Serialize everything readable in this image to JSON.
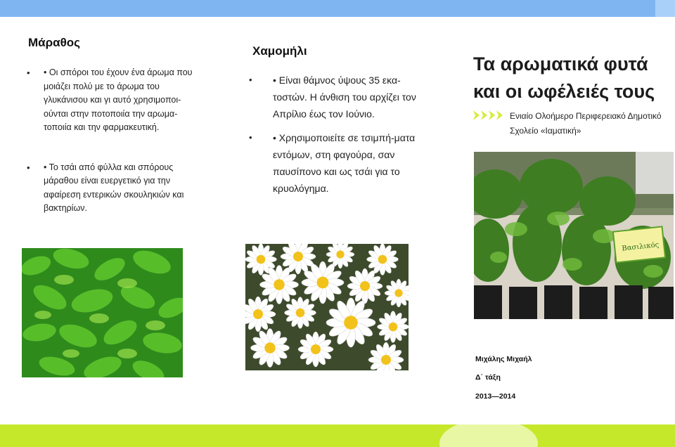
{
  "left_panel": {
    "heading": "Μάραθος",
    "items": [
      "• Οι σπόροι του έχουν ένα άρωμα που μοιάζει πολύ με το άρωμα του γλυκάνισου και γι αυτό χρησιμοποι-ούνται στην ποτοποιία την αρωμα-τοποιία και την φαρμακευτική.",
      "• Το τσάι από φύλλα και σπόρους μάραθου είναι ευεργετικό για την αφαίρεση εντερικών σκουληκιών και βακτηρίων."
    ]
  },
  "middle_panel": {
    "heading": "Χαμομήλι",
    "items": [
      "• Είναι θάμνος ύψους 35 εκα-τοστών. Η άνθιση του αρχίζει τον Απρίλιο έως τον Ιούνιο.",
      "• Χρησιμοποιείτε σε τσιμπή-ματα εντόμων, στη φαγούρα, σαν παυσίπονο και ως τσάι για το κρυολόγημα."
    ]
  },
  "right_panel": {
    "title": "Τα αρωματικά φυτά και οι ωφέλειές τους",
    "subtitle": "Ενιαίο Ολοήμερο Περιφερειακό Δημοτικό Σχολείο «Ιαματική»",
    "sign_label": "Βασιλικός",
    "author": "Μιχάλης Μιχαήλ",
    "class": "Δ΄ τάξη",
    "year": "2013—2014"
  },
  "bullet": "•",
  "icons": {
    "subtitle_marker": "double-arrow-icon"
  },
  "colors": {
    "top_bar": "#7fb6f2",
    "bottom_bar": "#c6e82a",
    "arrow": "#d4ec3a"
  }
}
